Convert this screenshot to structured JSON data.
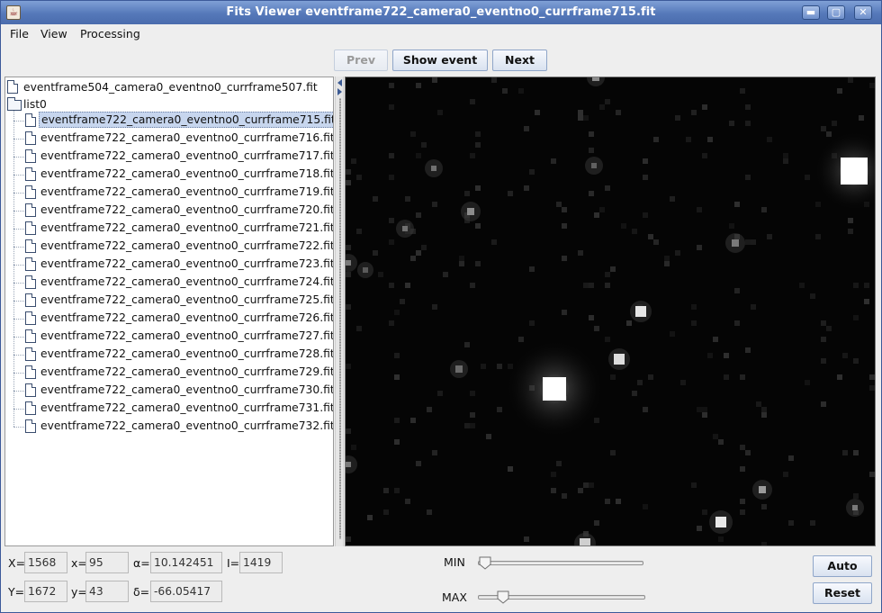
{
  "window": {
    "title": "Fits Viewer eventframe722_camera0_eventno0_currframe715.fit",
    "app_icon_glyph": "☕",
    "controls": {
      "minimize": "▬",
      "maximize": "▢",
      "close": "✕"
    }
  },
  "menu": {
    "items": [
      "File",
      "View",
      "Processing"
    ]
  },
  "toolbar": {
    "prev_label": "Prev",
    "prev_enabled": false,
    "show_event_label": "Show event",
    "next_label": "Next"
  },
  "tree": {
    "root_file": "eventframe504_camera0_eventno0_currframe507.fit",
    "folder": "list0",
    "selected_index": 0,
    "files": [
      "eventframe722_camera0_eventno0_currframe715.fit",
      "eventframe722_camera0_eventno0_currframe716.fit",
      "eventframe722_camera0_eventno0_currframe717.fit",
      "eventframe722_camera0_eventno0_currframe718.fit",
      "eventframe722_camera0_eventno0_currframe719.fit",
      "eventframe722_camera0_eventno0_currframe720.fit",
      "eventframe722_camera0_eventno0_currframe721.fit",
      "eventframe722_camera0_eventno0_currframe722.fit",
      "eventframe722_camera0_eventno0_currframe723.fit",
      "eventframe722_camera0_eventno0_currframe724.fit",
      "eventframe722_camera0_eventno0_currframe725.fit",
      "eventframe722_camera0_eventno0_currframe726.fit",
      "eventframe722_camera0_eventno0_currframe727.fit",
      "eventframe722_camera0_eventno0_currframe728.fit",
      "eventframe722_camera0_eventno0_currframe729.fit",
      "eventframe722_camera0_eventno0_currframe730.fit",
      "eventframe722_camera0_eventno0_currframe731.fit",
      "eventframe722_camera0_eventno0_currframe732.fit"
    ]
  },
  "status": {
    "X_label": "X=",
    "X_value": "1568",
    "x_label": "x=",
    "x_value": "95",
    "alpha_label": "α=",
    "alpha_value": "10.142451",
    "I_label": "I=",
    "I_value": "1419",
    "Y_label": "Y=",
    "Y_value": "1672",
    "y_label": "y=",
    "y_value": "43",
    "delta_label": "δ=",
    "delta_value": "-66.05417"
  },
  "sliders": {
    "min_label": "MIN",
    "min_level": 0.0,
    "max_label": "MAX",
    "max_level": 0.12
  },
  "buttons": {
    "auto_label": "Auto",
    "reset_label": "Reset"
  },
  "colors": {
    "titlebar": "#5578b9",
    "selection": "#c7d6ee",
    "image_background": "#050505"
  }
}
